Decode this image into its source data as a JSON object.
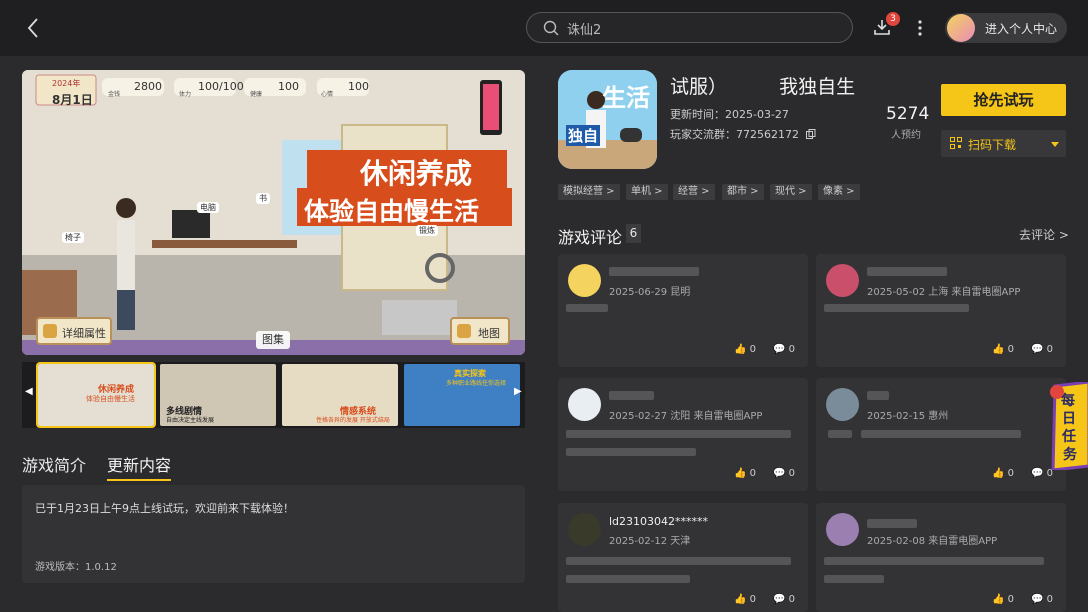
{
  "search": {
    "value": "诛仙2"
  },
  "topbar": {
    "download_badge": "3",
    "profile_label": "进入个人中心"
  },
  "hero": {
    "stats": {
      "year": "2024年",
      "date": "8月1日",
      "money": "2800",
      "stamina": "100/100",
      "health": "100",
      "mood": "100"
    },
    "stat_labels": {
      "money": "金钱",
      "stamina": "体力",
      "health": "健康",
      "mood": "心情"
    },
    "headline1": "休闲养成",
    "headline2": "体验自由慢生活",
    "object_labels": {
      "computer": "电脑",
      "book": "书",
      "chair": "椅子",
      "bike": "锻炼"
    },
    "btn_attr": "详细属性",
    "btn_map": "地图",
    "gallery_label": "图集"
  },
  "thumbs": [
    {
      "caption1": "休闲养成",
      "caption2": "体验自由慢生活"
    },
    {
      "caption1": "多线剧情",
      "caption2": "自由决定主线发展"
    },
    {
      "caption1": "情感系统",
      "caption2": "性格各异的发展 开放式结局"
    },
    {
      "caption1": "真实探索",
      "caption2": "多种职业路线任你选择"
    }
  ],
  "tabs": {
    "intro": "游戏简介",
    "update": "更新内容"
  },
  "update": {
    "text": "已于1月23日上午9点上线试玩，欢迎前来下载体验！",
    "version": "游戏版本：1.0.12"
  },
  "game": {
    "icon_text_top": "生活",
    "icon_text_bottom": "独自",
    "title_part1": "试服）",
    "title_part2": "我独自生",
    "update_time": "更新时间：2025-03-27",
    "group": "玩家交流群：772562172",
    "reserve_count": "5274",
    "reserve_label": "人预约",
    "trial_btn": "抢先试玩",
    "qr_btn": "扫码下载"
  },
  "tags": [
    "模拟经营 >",
    "单机 >",
    "经营 >",
    "都市 >",
    "现代 >",
    "像素 >"
  ],
  "reviews": {
    "title": "游戏评论",
    "count": "6",
    "go": "去评论 >",
    "items": [
      {
        "name": "",
        "date": "2025-06-29 昆明",
        "likes": "0",
        "comments": "0"
      },
      {
        "name": "",
        "date": "2025-05-02 上海 来自雷电圈APP",
        "likes": "0",
        "comments": "0"
      },
      {
        "name": "",
        "date": "2025-02-27 沈阳 来自雷电圈APP",
        "likes": "0",
        "comments": "0"
      },
      {
        "name": "",
        "date": "2025-02-15 惠州",
        "likes": "0",
        "comments": "0"
      },
      {
        "name": "ld23103042******",
        "date": "2025-02-12 天津",
        "likes": "0",
        "comments": "0"
      },
      {
        "name": "",
        "date": "2025-02-08 来自雷电圈APP",
        "likes": "0",
        "comments": "0"
      }
    ]
  },
  "mission": {
    "line1": "每",
    "line2": "日",
    "line3": "任",
    "line4": "务"
  },
  "colors": {
    "accent": "#f5c518",
    "badge": "#e2453c",
    "background": "#2b2b2d",
    "card": "#333336"
  }
}
